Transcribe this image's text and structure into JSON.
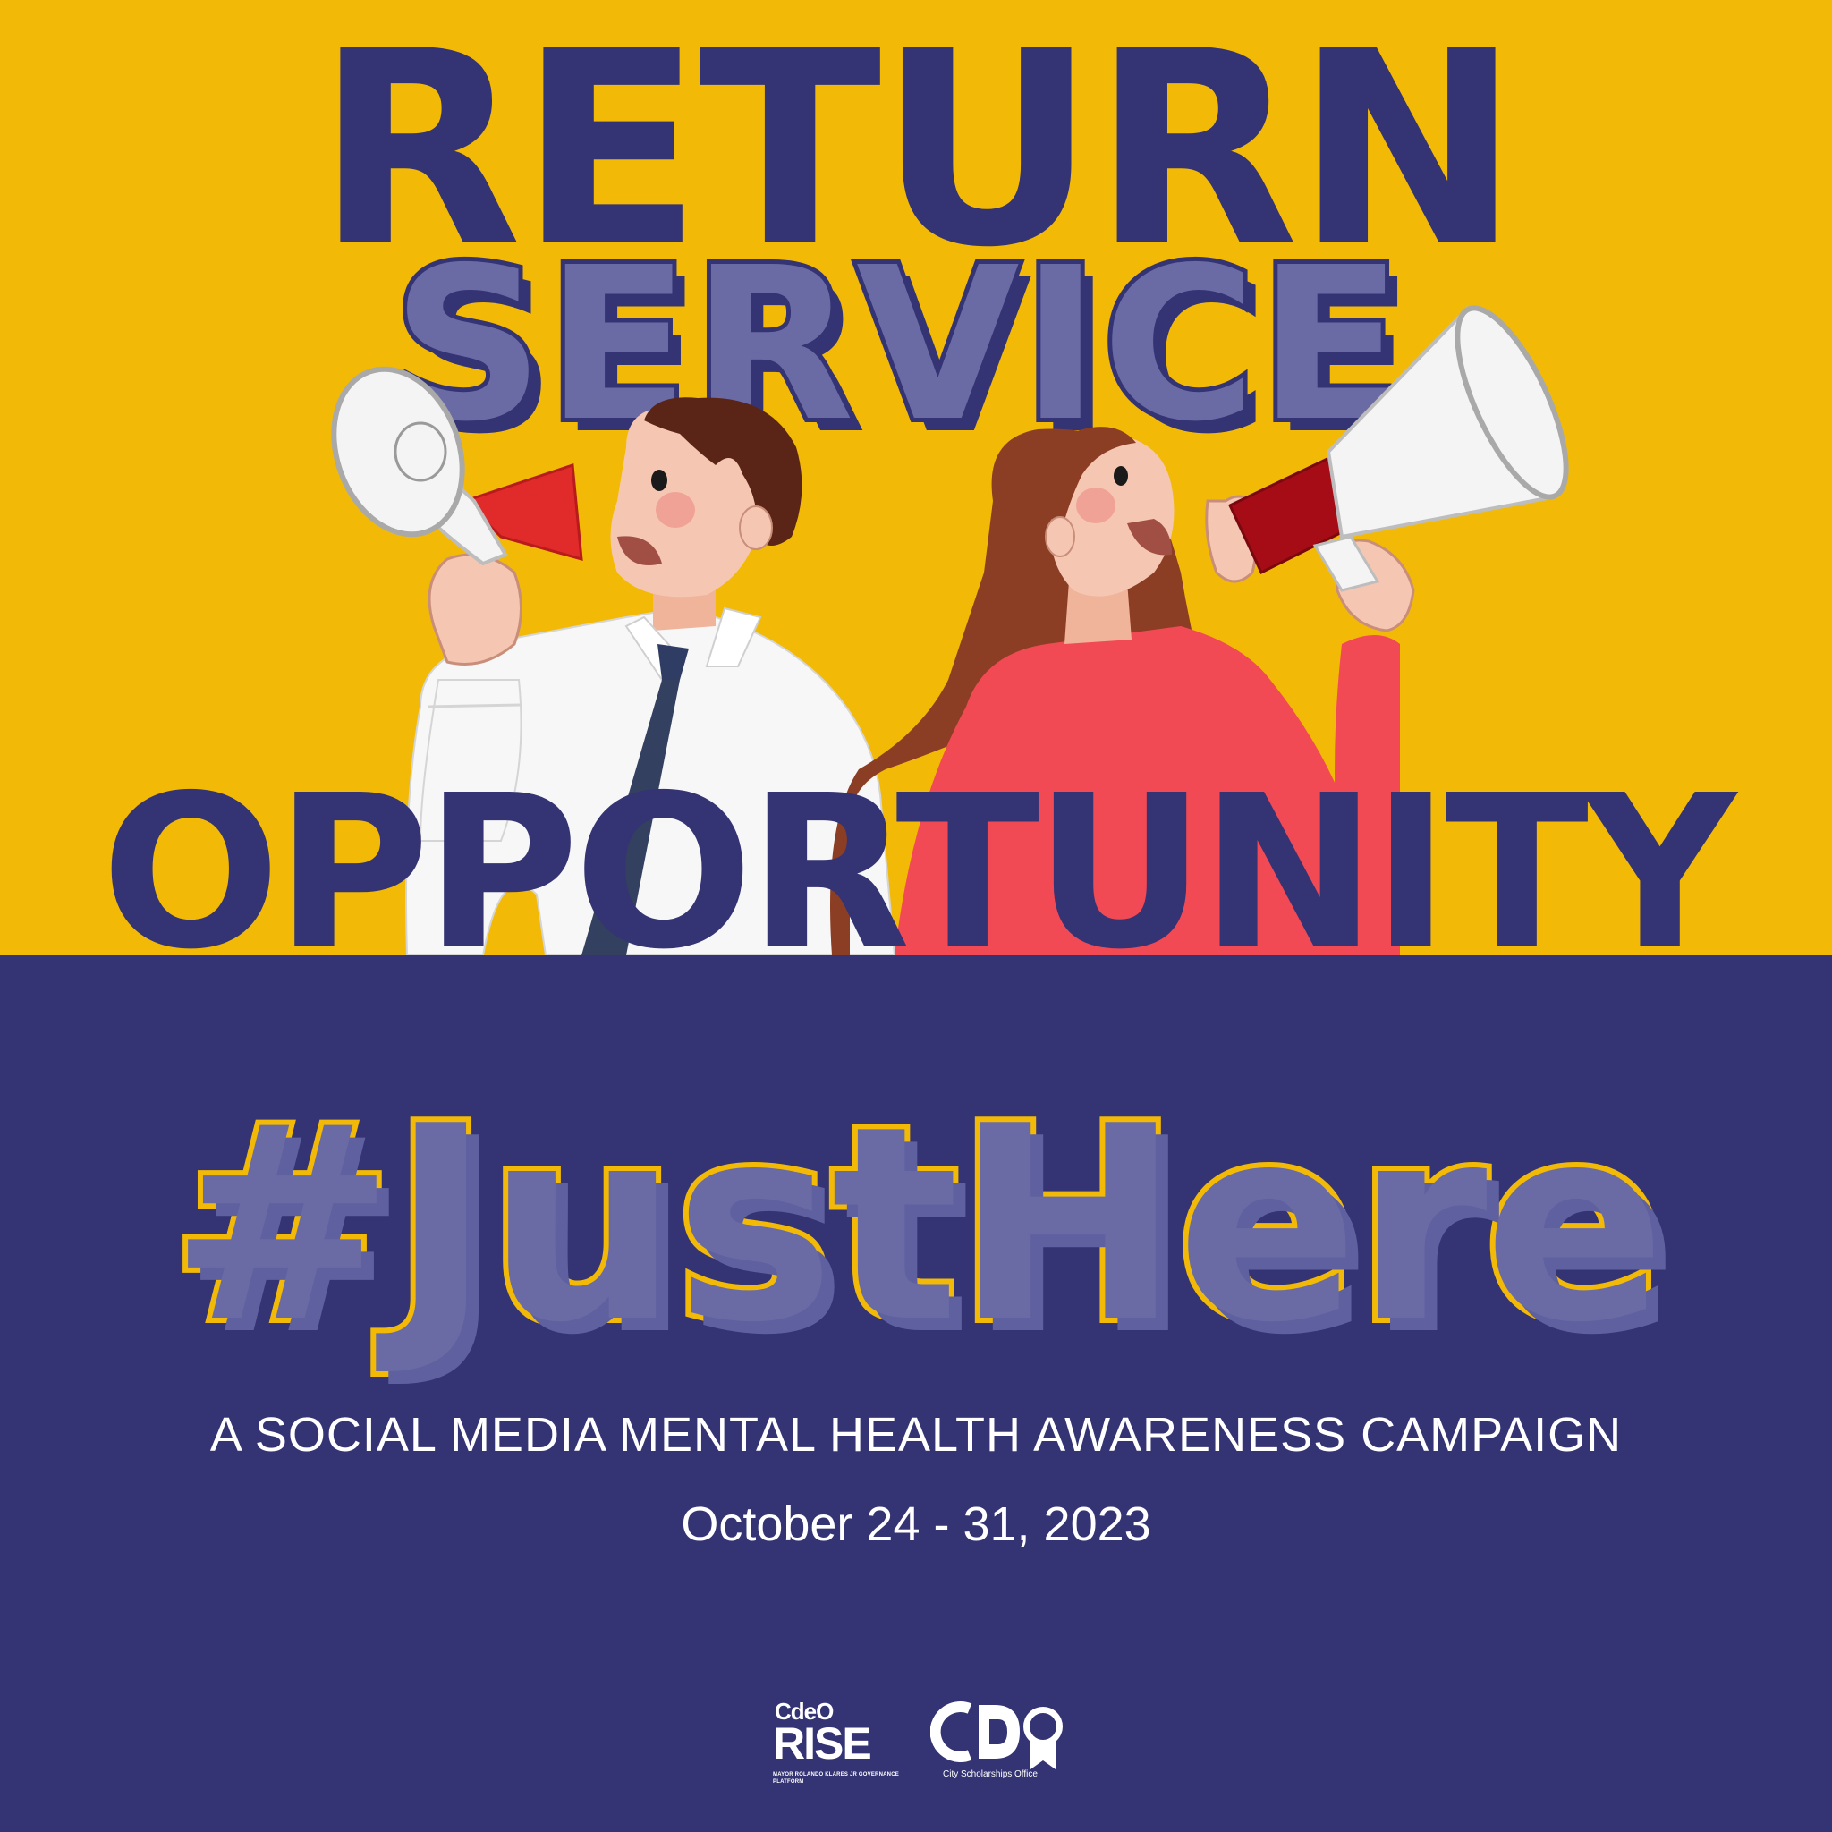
{
  "headline": {
    "line1": "RETURN",
    "line2": "SERVICE",
    "line3": "OPPORTUNITY"
  },
  "hashtag": "#JustHere",
  "subtitle": "A SOCIAL MEDIA MENTAL HEALTH AWARENESS CAMPAIGN",
  "dates": "October 24 - 31, 2023",
  "logos": {
    "rise": {
      "top": "CdeO",
      "main": "RISE",
      "tagline": "MAYOR ROLANDO KLARES JR GOVERNANCE PLATFORM"
    },
    "cso": {
      "mark": "CSO",
      "caption": "City Scholarships Office"
    }
  },
  "colors": {
    "yellow": "#F2BA06",
    "navy": "#343373",
    "lavender": "#6A6BA5",
    "red_shirt": "#F24A55",
    "megaphone_red": "#E12A2A",
    "white": "#FFFFFF"
  },
  "icons": [
    "megaphone-icon",
    "megaphone-icon",
    "ribbon-icon"
  ]
}
